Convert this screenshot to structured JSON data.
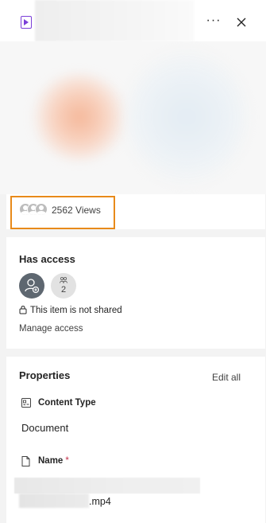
{
  "header": {
    "file_type_icon": "video-file-icon",
    "more_label": "···",
    "close_icon": "close-icon"
  },
  "views": {
    "count_text": "2562 Views"
  },
  "access": {
    "title": "Has access",
    "group_count": "2",
    "share_status": "This item is not shared",
    "manage_link": "Manage access"
  },
  "properties": {
    "title": "Properties",
    "edit_all": "Edit all",
    "content_type_label": "Content Type",
    "content_type_value": "Document",
    "name_label": "Name",
    "name_required": "*",
    "name_extension": ".mp4"
  },
  "colors": {
    "highlight": "#e88a1a",
    "file_icon": "#7b3fd8",
    "required": "#c4314b"
  }
}
